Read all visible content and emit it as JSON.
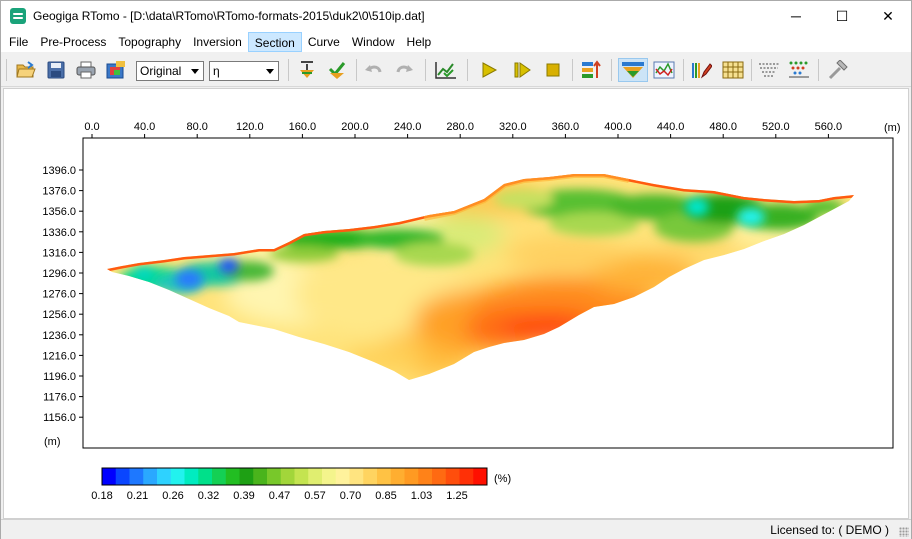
{
  "window": {
    "title": "Geogiga RTomo - [D:\\data\\RTomo\\RTomo-formats-2015\\duk2\\0\\510ip.dat]",
    "minimize": "─",
    "maximize": "☐",
    "close": "✕"
  },
  "menu": [
    {
      "label": "File"
    },
    {
      "label": "Pre-Process"
    },
    {
      "label": "Topography"
    },
    {
      "label": "Inversion"
    },
    {
      "label": "Section"
    },
    {
      "label": "Curve"
    },
    {
      "label": "Window"
    },
    {
      "label": "Help"
    }
  ],
  "toolbar": {
    "view_combo_value": "Original",
    "param_combo_value": "η",
    "icons": [
      "open-file-icon",
      "save-icon",
      "print-icon",
      "export-image-icon",
      "pick-down-icon",
      "check-pick-icon",
      "undo-icon",
      "redo-icon",
      "chart-check-icon",
      "play-icon",
      "step-play-icon",
      "stop-icon",
      "sort-up-icon",
      "section-view-icon",
      "curve-view-icon",
      "pencil-icon",
      "grid-table-icon",
      "mesh-icon",
      "mesh-dots-icon",
      "hammer-icon"
    ]
  },
  "section": {
    "x_unit": "(m)",
    "y_unit": "(m)",
    "x_ticks": [
      "0.0",
      "40.0",
      "80.0",
      "120.0",
      "160.0",
      "200.0",
      "240.0",
      "280.0",
      "320.0",
      "360.0",
      "400.0",
      "440.0",
      "480.0",
      "520.0",
      "560.0"
    ],
    "y_ticks": [
      "1396.0",
      "1376.0",
      "1356.0",
      "1336.0",
      "1316.0",
      "1296.0",
      "1276.0",
      "1256.0",
      "1236.0",
      "1216.0",
      "1196.0",
      "1176.0",
      "1156.0"
    ],
    "colorbar_unit": "(%)",
    "colorbar_labels": [
      "0.18",
      "0.21",
      "0.26",
      "0.32",
      "0.39",
      "0.47",
      "0.57",
      "0.70",
      "0.85",
      "1.03",
      "1.25"
    ],
    "colorbar_colors": [
      "#0000ff",
      "#0a46ff",
      "#1e78ff",
      "#2aa8ff",
      "#2ed2ff",
      "#22f2ee",
      "#00ecc0",
      "#00e08a",
      "#14d054",
      "#22be22",
      "#1ea014",
      "#4ab41c",
      "#78c82a",
      "#a2d63a",
      "#c4e450",
      "#e0ee70",
      "#f4f48c",
      "#fff29c",
      "#ffe480",
      "#ffd460",
      "#ffc244",
      "#ffae30",
      "#ff9a22",
      "#ff8218",
      "#ff6a12",
      "#ff4e0c",
      "#ff3006",
      "#ff1000"
    ]
  },
  "status": {
    "license": "Licensed to: ( DEMO )"
  }
}
